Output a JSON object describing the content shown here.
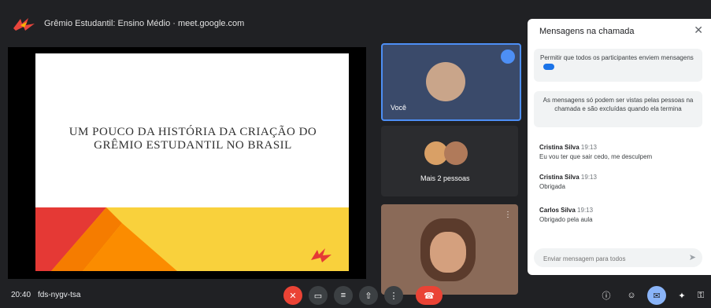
{
  "window": {
    "title": "Grêmio Estudantil: Ensino Médio · meet.google.com"
  },
  "slide": {
    "title": "UM POUCO DA HISTÓRIA DA CRIAÇÃO DO GRÊMIO ESTUDANTIL NO BRASIL"
  },
  "participants": {
    "tile1_name": "Você",
    "tile2_name": "Mais 2 pessoas",
    "tile3_name": ""
  },
  "chat": {
    "title": "Mensagens na chamada",
    "permission_text": "Permitir que todos os participantes enviem mensagens",
    "notice_text": "As mensagens só podem ser vistas pelas pessoas na chamada e são excluídas quando ela termina",
    "messages": [
      {
        "sender": "Cristina Silva",
        "time": "19:13",
        "text": "Eu vou ter que sair cedo, me desculpem"
      },
      {
        "sender": "Cristina Silva",
        "time": "19:13",
        "text": "Obrigada"
      },
      {
        "sender": "Carlos Silva",
        "time": "19:13",
        "text": "Obrigado pela aula"
      }
    ],
    "input_placeholder": "Enviar mensagem para todos"
  },
  "bottom_bar": {
    "time": "20:40",
    "meeting_code": "fds-nygv-tsa"
  },
  "icons": {
    "logo": "meet-logo-icon",
    "mic": "mic-off-icon",
    "camera": "camera-off-icon",
    "captions": "captions-icon",
    "present": "present-icon",
    "more": "more-vert-icon",
    "end": "end-call-icon",
    "info": "info-icon",
    "people": "people-icon",
    "chat": "chat-icon",
    "activities": "activities-icon"
  },
  "colors": {
    "background": "#202124",
    "accent": "#4d8ff5",
    "end_call": "#ea4335"
  }
}
